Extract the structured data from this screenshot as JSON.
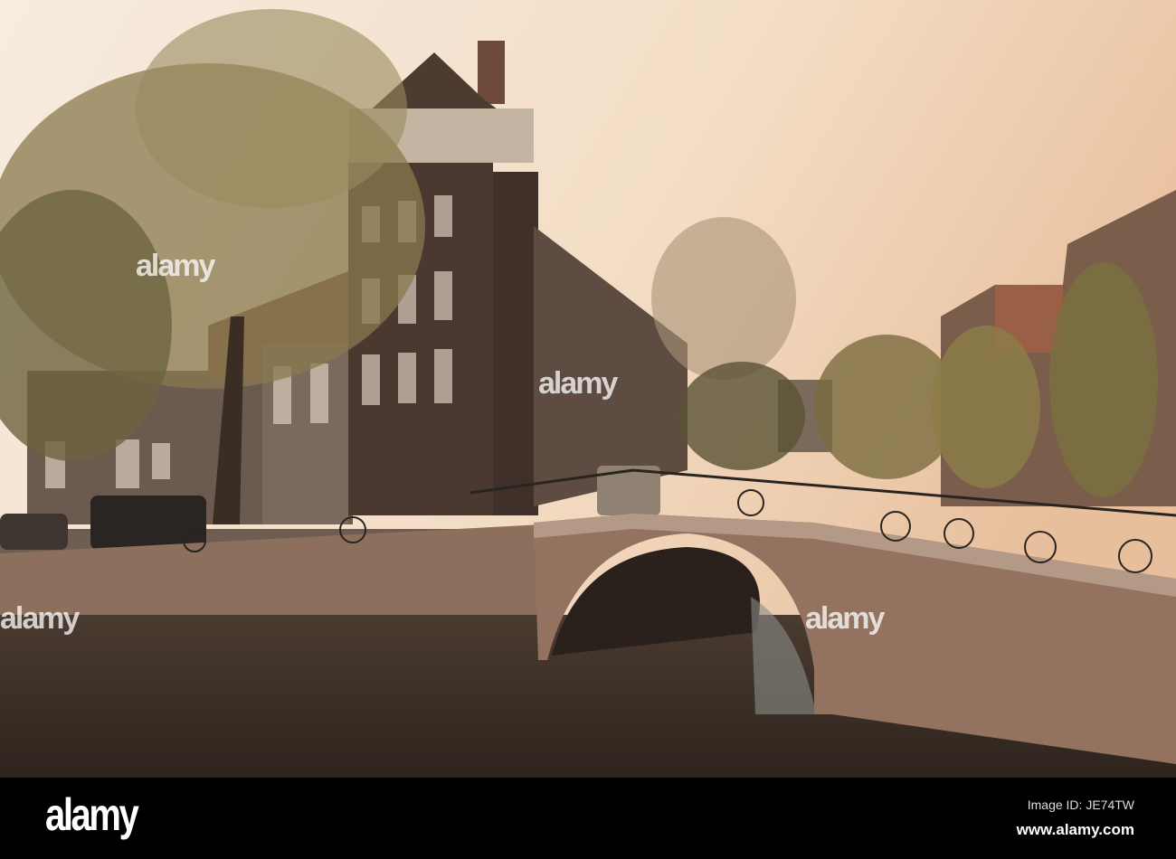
{
  "photo": {
    "subject": "Amsterdam canal with arched brick bridge and houses"
  },
  "watermark": {
    "text": "alamy"
  },
  "footer": {
    "logo": "alamy",
    "image_id": "Image ID: JE74TW",
    "website": "www.alamy.com"
  }
}
